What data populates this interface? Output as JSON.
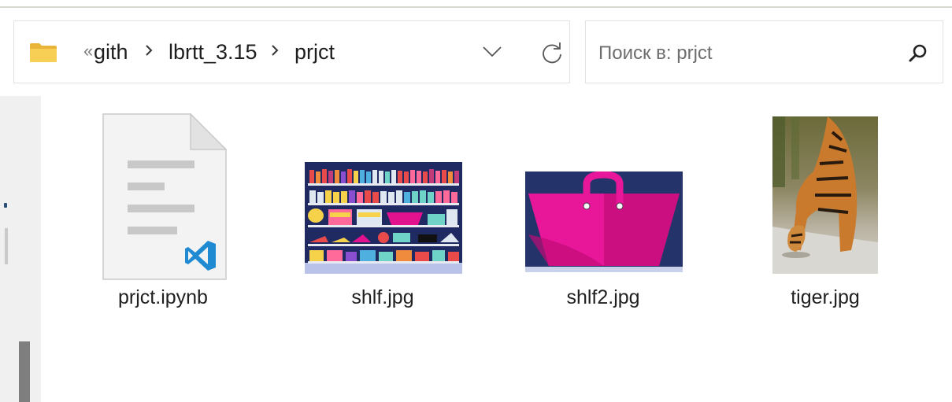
{
  "breadcrumb": {
    "overflow_glyph": "«",
    "items": [
      "gith",
      "lbrtt_3.15",
      "prjct"
    ]
  },
  "search": {
    "placeholder": "Поиск в: prjct",
    "value": ""
  },
  "icons": {
    "folder": "folder-icon",
    "chevron": "chevron-down-icon",
    "refresh": "refresh-icon",
    "search": "search-icon",
    "notebook_file": "document-icon",
    "vscode_badge": "vscode-icon"
  },
  "colors": {
    "folder_yellow": "#f4c542",
    "vscode_blue": "#1f8ad2",
    "navy": "#24346b",
    "magenta": "#e2128f"
  },
  "files": [
    {
      "name": "prjct.ipynb",
      "kind": "notebook"
    },
    {
      "name": "shlf.jpg",
      "kind": "image"
    },
    {
      "name": "shlf2.jpg",
      "kind": "image"
    },
    {
      "name": "tiger.jpg",
      "kind": "image"
    }
  ]
}
